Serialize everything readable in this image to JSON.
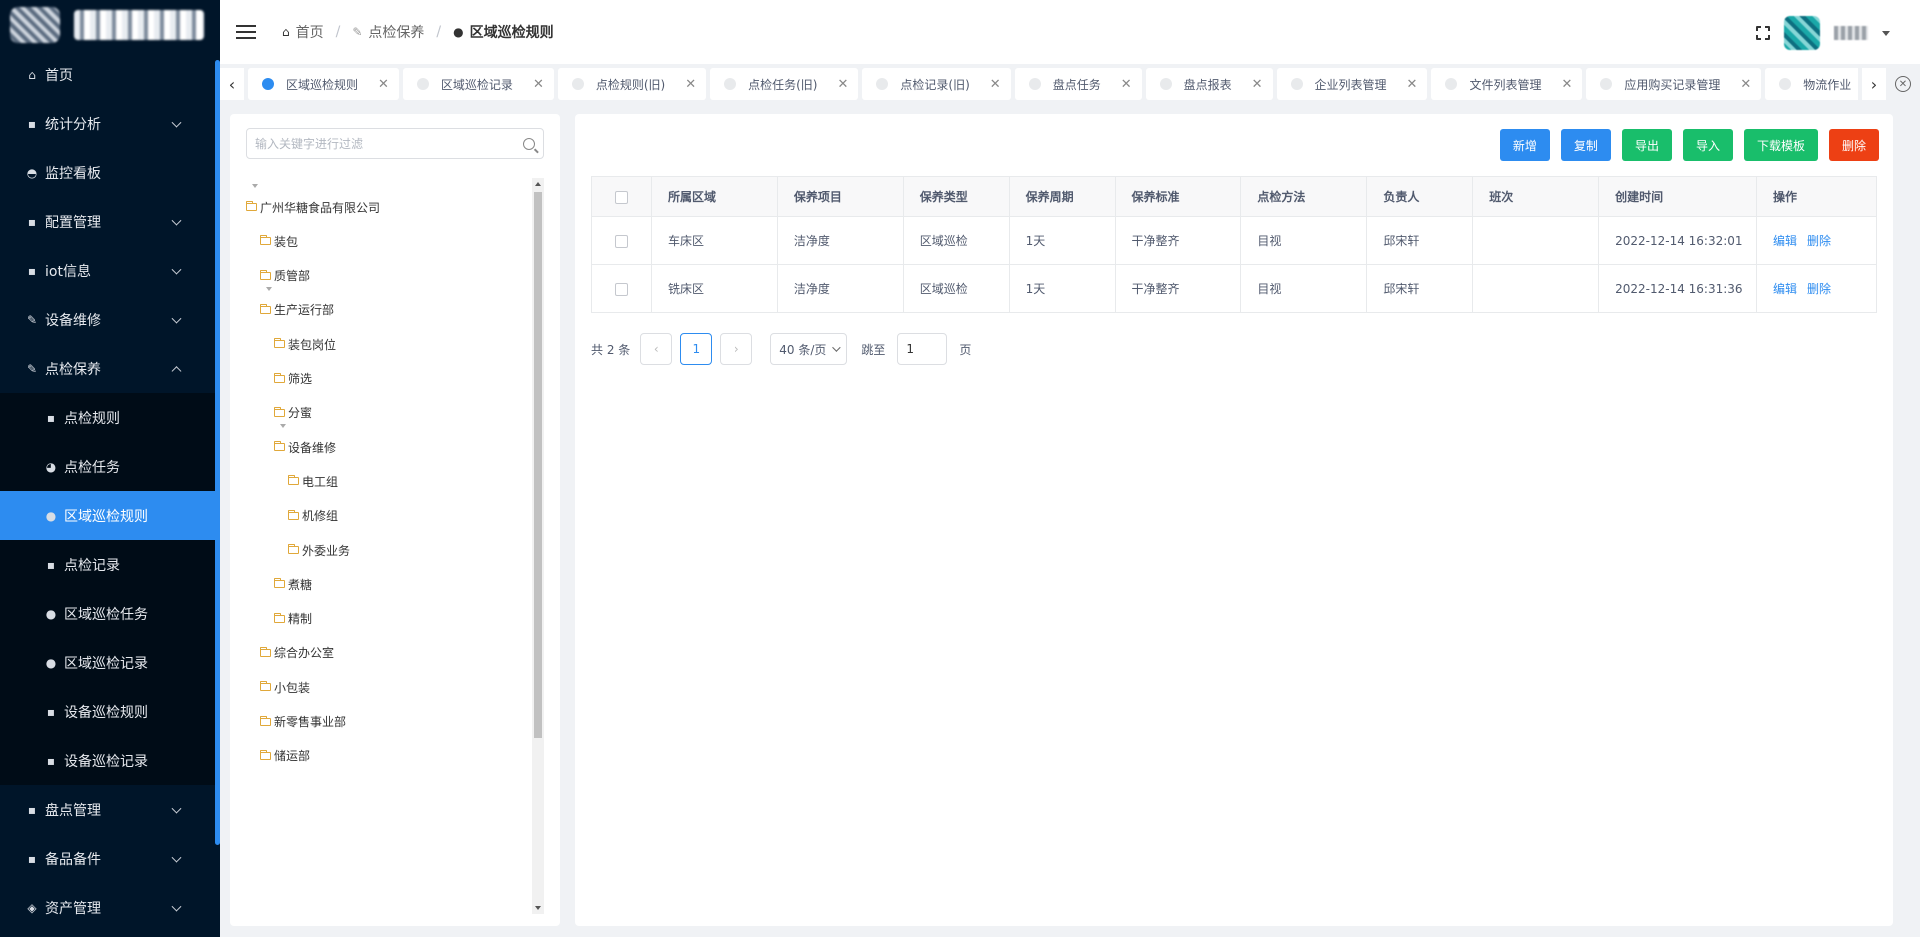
{
  "sidebar": {
    "items": [
      {
        "label": "首页",
        "icon": "home-icon",
        "glyph": "⌂"
      },
      {
        "label": "统计分析",
        "icon": "document-icon",
        "glyph": "▪",
        "arrow": "down"
      },
      {
        "label": "监控看板",
        "icon": "dashboard-icon",
        "glyph": "◓"
      },
      {
        "label": "配置管理",
        "icon": "document-icon",
        "glyph": "▪",
        "arrow": "down"
      },
      {
        "label": "iot信息",
        "icon": "document-icon",
        "glyph": "▪",
        "arrow": "down"
      },
      {
        "label": "设备维修",
        "icon": "wrench-icon",
        "glyph": "✎",
        "arrow": "down"
      },
      {
        "label": "点检保养",
        "icon": "wrench-icon",
        "glyph": "✎",
        "arrow": "up"
      }
    ],
    "sub_items": [
      {
        "label": "点检规则",
        "icon": "document-icon",
        "glyph": "▪"
      },
      {
        "label": "点检任务",
        "icon": "palette-icon",
        "glyph": "◕"
      },
      {
        "label": "区域巡检规则",
        "icon": "location-pin-icon",
        "glyph": "●",
        "active": true
      },
      {
        "label": "点检记录",
        "icon": "record-icon",
        "glyph": "▪"
      },
      {
        "label": "区域巡检任务",
        "icon": "location-pin-icon",
        "glyph": "●"
      },
      {
        "label": "区域巡检记录",
        "icon": "location-pin-icon",
        "glyph": "●"
      },
      {
        "label": "设备巡检规则",
        "icon": "document-icon",
        "glyph": "▪"
      },
      {
        "label": "设备巡检记录",
        "icon": "record-icon",
        "glyph": "▪"
      }
    ],
    "bottom_items": [
      {
        "label": "盘点管理",
        "icon": "document-icon",
        "glyph": "▪",
        "arrow": "down"
      },
      {
        "label": "备品备件",
        "icon": "document-icon",
        "glyph": "▪",
        "arrow": "down"
      },
      {
        "label": "资产管理",
        "icon": "cube-icon",
        "glyph": "◈",
        "arrow": "down"
      }
    ]
  },
  "breadcrumb": {
    "home": "首页",
    "parent": "点检保养",
    "current": "区域巡检规则"
  },
  "tabs": [
    {
      "label": "区域巡检规则",
      "active": true
    },
    {
      "label": "区域巡检记录"
    },
    {
      "label": "点检规则(旧)"
    },
    {
      "label": "点检任务(旧)"
    },
    {
      "label": "点检记录(旧)"
    },
    {
      "label": "盘点任务"
    },
    {
      "label": "盘点报表"
    },
    {
      "label": "企业列表管理"
    },
    {
      "label": "文件列表管理"
    },
    {
      "label": "应用购买记录管理"
    },
    {
      "label": "物流作业"
    }
  ],
  "tree": {
    "search_placeholder": "输入关键字进行过滤",
    "nodes": [
      {
        "label": "广州华糖食品有限公司",
        "level": 0,
        "expanded": true
      },
      {
        "label": "装包",
        "level": 1
      },
      {
        "label": "质管部",
        "level": 1
      },
      {
        "label": "生产运行部",
        "level": 1,
        "expanded": true
      },
      {
        "label": "装包岗位",
        "level": 2
      },
      {
        "label": "筛选",
        "level": 2
      },
      {
        "label": "分蜜",
        "level": 2
      },
      {
        "label": "设备维修",
        "level": 2,
        "expanded": true
      },
      {
        "label": "电工组",
        "level": 3
      },
      {
        "label": "机修组",
        "level": 3
      },
      {
        "label": "外委业务",
        "level": 3
      },
      {
        "label": "煮糖",
        "level": 2
      },
      {
        "label": "精制",
        "level": 2
      },
      {
        "label": "综合办公室",
        "level": 1
      },
      {
        "label": "小包装",
        "level": 1
      },
      {
        "label": "新零售事业部",
        "level": 1
      },
      {
        "label": "储运部",
        "level": 1
      }
    ]
  },
  "toolbar": {
    "add": "新增",
    "copy": "复制",
    "export": "导出",
    "import": "导入",
    "download_template": "下载模板",
    "delete": "删除"
  },
  "table": {
    "columns": [
      "所属区域",
      "保养项目",
      "保养类型",
      "保养周期",
      "保养标准",
      "点检方法",
      "负责人",
      "班次",
      "创建时间",
      "操作"
    ],
    "rows": [
      {
        "cells": [
          "车床区",
          "洁净度",
          "区域巡检",
          "1天",
          "干净整齐",
          "目视",
          "邱宋轩",
          "",
          "2022-12-14 16:32:01"
        ],
        "edit": "编辑",
        "delete": "删除"
      },
      {
        "cells": [
          "铣床区",
          "洁净度",
          "区域巡检",
          "1天",
          "干净整齐",
          "目视",
          "邱宋轩",
          "",
          "2022-12-14 16:31:36"
        ],
        "edit": "编辑",
        "delete": "删除"
      }
    ]
  },
  "pagination": {
    "total": "共 2 条",
    "current_page": "1",
    "page_size": "40 条/页",
    "jump_label": "跳至",
    "jump_value": "1",
    "page_suffix": "页"
  },
  "colors": {
    "sidebar_bg": "#001529",
    "accent": "#2d8cf0",
    "success": "#19be6b",
    "danger": "#ed4014"
  }
}
